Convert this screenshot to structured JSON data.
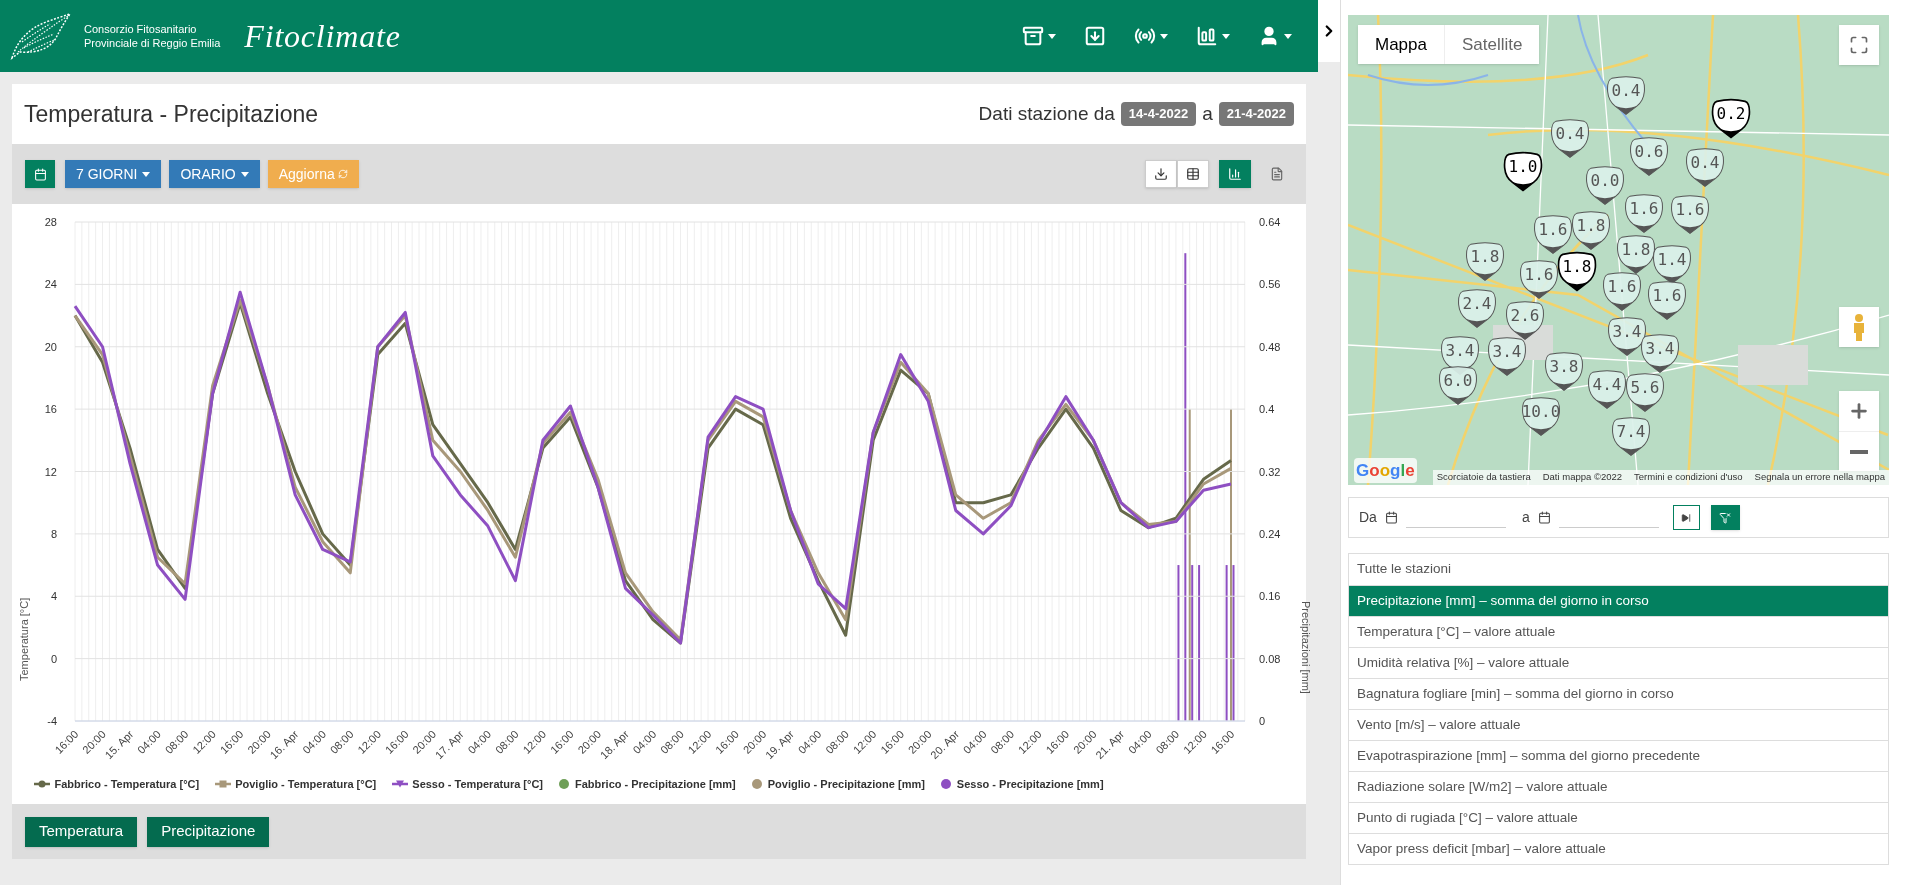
{
  "header": {
    "org_line_1": "Consorzio Fitosanitario",
    "org_line_2": "Provinciale di Reggio Emilia",
    "app_name": "Fitoclimate",
    "menu": [
      {
        "kind": "archive",
        "caret": true
      },
      {
        "kind": "download",
        "caret": false
      },
      {
        "kind": "broadcast",
        "caret": true
      },
      {
        "kind": "chart",
        "caret": true
      },
      {
        "kind": "user",
        "caret": true
      }
    ]
  },
  "panel": {
    "title": "Temperatura - Precipitazione",
    "range_label": "Dati stazione da",
    "date_from": "14-4-2022",
    "range_sep": "a",
    "date_to": "21-4-2022"
  },
  "toolbar": {
    "period": "7 GIORNI",
    "resolution": "ORARIO",
    "refresh": "Aggiorna",
    "views": [
      {
        "kind": "table",
        "selected": false
      },
      {
        "kind": "chart",
        "selected": true
      },
      {
        "kind": "report",
        "selected": false
      }
    ]
  },
  "temperature_chart": {
    "chart_data": {
      "type": "line",
      "grid": true,
      "ylabel": "Temperatura [°C]",
      "categories": [
        null,
        null,
        null,
        null,
        null,
        null,
        null,
        null,
        null,
        null,
        null,
        null,
        null,
        null,
        null,
        null,
        null,
        null,
        null,
        null,
        null,
        null,
        null,
        null,
        null,
        null,
        null,
        null,
        null,
        null,
        null,
        null,
        null,
        null,
        null,
        null,
        null,
        null,
        null,
        null,
        null,
        null,
        null
      ],
      "ylim": [
        -4,
        28
      ],
      "yticks": [
        -4,
        0,
        4,
        8,
        12,
        16,
        20,
        24,
        28
      ],
      "series": [
        {
          "name": "Fabbrico - Temperatura [°C]",
          "color": "#66694a",
          "values": [
            22,
            19,
            13.5,
            7,
            4.5,
            17,
            22.8,
            17,
            12,
            8,
            6,
            19.5,
            21.5,
            15,
            12.5,
            10,
            7,
            13.5,
            15.5,
            11,
            5,
            2.5,
            1,
            13.5,
            16,
            15,
            9,
            5,
            1.5,
            14,
            18.5,
            17,
            10,
            10,
            10.5,
            13.5,
            16,
            13.5,
            9.5,
            8.4,
            9,
            11.5,
            12.7
          ]
        },
        {
          "name": "Poviglio - Temperatura [°C]",
          "color": "#a8987a",
          "values": [
            22,
            19.5,
            13,
            6.5,
            4.8,
            17.5,
            23,
            17.5,
            11,
            7.5,
            5.5,
            20,
            22,
            14,
            12,
            9.5,
            6.5,
            13.8,
            15.8,
            11.5,
            5.5,
            3,
            1.2,
            14,
            16.5,
            15.5,
            9.5,
            5.5,
            2.5,
            14.5,
            19,
            17,
            10.5,
            9,
            10,
            14,
            16.3,
            14,
            10,
            8.6,
            8.8,
            11.2,
            12.2
          ]
        },
        {
          "name": "Sesso - Temperatura [°C]",
          "color": "#8e4fc2",
          "values": [
            22.6,
            20,
            12.5,
            6,
            3.8,
            17,
            23.5,
            17.5,
            10.5,
            7,
            6.2,
            20,
            22.2,
            13,
            10.5,
            8.5,
            5,
            14,
            16.2,
            11,
            4.5,
            2.8,
            1,
            14.2,
            16.8,
            16,
            9.5,
            4.8,
            3.2,
            14.5,
            19.5,
            16.5,
            9.5,
            8,
            9.8,
            13.8,
            16.8,
            14,
            10,
            8.4,
            8.8,
            10.8,
            11.2
          ]
        }
      ]
    }
  },
  "precipitation_chart": {
    "chart_data": {
      "type": "bar",
      "grid": true,
      "ylabel": "Precipitazioni [mm]",
      "categories": [
        "16:00",
        null,
        null,
        null,
        "20:00",
        null,
        null,
        null,
        "15. Apr",
        null,
        null,
        null,
        "04:00",
        null,
        null,
        null,
        "08:00",
        null,
        null,
        null,
        "12:00",
        null,
        null,
        null,
        "16:00",
        null,
        null,
        null,
        "20:00",
        null,
        null,
        null,
        "16. Apr",
        null,
        null,
        null,
        "04:00",
        null,
        null,
        null,
        "08:00",
        null,
        null,
        null,
        "12:00",
        null,
        null,
        null,
        "16:00",
        null,
        null,
        null,
        "20:00",
        null,
        null,
        null,
        "17. Apr",
        null,
        null,
        null,
        "04:00",
        null,
        null,
        null,
        "08:00",
        null,
        null,
        null,
        "12:00",
        null,
        null,
        null,
        "16:00",
        null,
        null,
        null,
        "20:00",
        null,
        null,
        null,
        "18. Apr",
        null,
        null,
        null,
        "04:00",
        null,
        null,
        null,
        "08:00",
        null,
        null,
        null,
        "12:00",
        null,
        null,
        null,
        "16:00",
        null,
        null,
        null,
        "20:00",
        null,
        null,
        null,
        "19. Apr",
        null,
        null,
        null,
        "04:00",
        null,
        null,
        null,
        "08:00",
        null,
        null,
        null,
        "12:00",
        null,
        null,
        null,
        "16:00",
        null,
        null,
        null,
        "20:00",
        null,
        null,
        null,
        "20. Apr",
        null,
        null,
        null,
        "04:00",
        null,
        null,
        null,
        "08:00",
        null,
        null,
        null,
        "12:00",
        null,
        null,
        null,
        "16:00",
        null,
        null,
        null,
        "20:00",
        null,
        null,
        null,
        "21. Apr",
        null,
        null,
        null,
        "04:00",
        null,
        null,
        null,
        "08:00",
        null,
        null,
        null,
        "12:00",
        null,
        null,
        null,
        "16:00"
      ],
      "ylim": [
        0,
        0.64
      ],
      "yticks": [
        0,
        0.08,
        0.16,
        0.24,
        0.32,
        0.4,
        0.48,
        0.56,
        0.64
      ],
      "series": [
        {
          "name": "Fabbrico - Precipitazione [mm]",
          "color": "#6e9f57",
          "values": [
            0,
            0,
            0,
            0,
            0,
            0,
            0,
            0,
            0,
            0,
            0,
            0,
            0,
            0,
            0,
            0,
            0,
            0,
            0,
            0,
            0,
            0,
            0,
            0,
            0,
            0,
            0,
            0,
            0,
            0,
            0,
            0,
            0,
            0,
            0,
            0,
            0,
            0,
            0,
            0,
            0,
            0,
            0,
            0,
            0,
            0,
            0,
            0,
            0,
            0,
            0,
            0,
            0,
            0,
            0,
            0,
            0,
            0,
            0,
            0,
            0,
            0,
            0,
            0,
            0,
            0,
            0,
            0,
            0,
            0,
            0,
            0,
            0,
            0,
            0,
            0,
            0,
            0,
            0,
            0,
            0,
            0,
            0,
            0,
            0,
            0,
            0,
            0,
            0,
            0,
            0,
            0,
            0,
            0,
            0,
            0,
            0,
            0,
            0,
            0,
            0,
            0,
            0,
            0,
            0,
            0,
            0,
            0,
            0,
            0,
            0,
            0,
            0,
            0,
            0,
            0,
            0,
            0,
            0,
            0,
            0,
            0,
            0,
            0,
            0,
            0,
            0,
            0,
            0,
            0,
            0,
            0,
            0,
            0,
            0,
            0,
            0,
            0,
            0,
            0,
            0,
            0,
            0,
            0,
            0,
            0,
            0,
            0,
            0,
            0,
            0,
            0,
            0,
            0,
            0,
            0,
            0,
            0,
            0,
            0,
            0,
            0,
            0,
            0,
            0,
            0,
            0,
            0,
            0
          ]
        },
        {
          "name": "Poviglio - Precipitazione [mm]",
          "color": "#a8987a",
          "values": [
            0,
            0,
            0,
            0,
            0,
            0,
            0,
            0,
            0,
            0,
            0,
            0,
            0,
            0,
            0,
            0,
            0,
            0,
            0,
            0,
            0,
            0,
            0,
            0,
            0,
            0,
            0,
            0,
            0,
            0,
            0,
            0,
            0,
            0,
            0,
            0,
            0,
            0,
            0,
            0,
            0,
            0,
            0,
            0,
            0,
            0,
            0,
            0,
            0,
            0,
            0,
            0,
            0,
            0,
            0,
            0,
            0,
            0,
            0,
            0,
            0,
            0,
            0,
            0,
            0,
            0,
            0,
            0,
            0,
            0,
            0,
            0,
            0,
            0,
            0,
            0,
            0,
            0,
            0,
            0,
            0,
            0,
            0,
            0,
            0,
            0,
            0,
            0,
            0,
            0,
            0,
            0,
            0,
            0,
            0,
            0,
            0,
            0,
            0,
            0,
            0,
            0,
            0,
            0,
            0,
            0,
            0,
            0,
            0,
            0,
            0,
            0,
            0,
            0,
            0,
            0,
            0,
            0,
            0,
            0,
            0,
            0,
            0,
            0,
            0,
            0,
            0,
            0,
            0,
            0,
            0,
            0,
            0,
            0,
            0,
            0,
            0,
            0,
            0,
            0,
            0,
            0,
            0,
            0,
            0,
            0,
            0,
            0,
            0,
            0,
            0,
            0,
            0,
            0,
            0,
            0,
            0,
            0,
            0,
            0,
            0,
            0,
            0.4,
            0,
            0,
            0,
            0,
            0,
            0.4
          ]
        },
        {
          "name": "Sesso - Precipitazione [mm]",
          "color": "#8e4fc2",
          "values": [
            0,
            0,
            0,
            0,
            0,
            0,
            0,
            0,
            0,
            0,
            0,
            0,
            0,
            0,
            0,
            0,
            0,
            0,
            0,
            0,
            0,
            0,
            0,
            0,
            0,
            0,
            0,
            0,
            0,
            0,
            0,
            0,
            0,
            0,
            0,
            0,
            0,
            0,
            0,
            0,
            0,
            0,
            0,
            0,
            0,
            0,
            0,
            0,
            0,
            0,
            0,
            0,
            0,
            0,
            0,
            0,
            0,
            0,
            0,
            0,
            0,
            0,
            0,
            0,
            0,
            0,
            0,
            0,
            0,
            0,
            0,
            0,
            0,
            0,
            0,
            0,
            0,
            0,
            0,
            0,
            0,
            0,
            0,
            0,
            0,
            0,
            0,
            0,
            0,
            0,
            0,
            0,
            0,
            0,
            0,
            0,
            0,
            0,
            0,
            0,
            0,
            0,
            0,
            0,
            0,
            0,
            0,
            0,
            0,
            0,
            0,
            0,
            0,
            0,
            0,
            0,
            0,
            0,
            0,
            0,
            0,
            0,
            0,
            0,
            0,
            0,
            0,
            0,
            0,
            0,
            0,
            0,
            0,
            0,
            0,
            0,
            0,
            0,
            0,
            0,
            0,
            0,
            0,
            0,
            0,
            0,
            0,
            0,
            0,
            0,
            0,
            0,
            0,
            0,
            0,
            0,
            0,
            0,
            0,
            0,
            0.2,
            0.6,
            0.2,
            0.2,
            0,
            0,
            0,
            0.2,
            0.2
          ]
        }
      ]
    }
  },
  "bottom_buttons": [
    "Temperatura",
    "Precipitazione"
  ],
  "map": {
    "tabs": [
      {
        "label": "Mappa",
        "selected": true
      },
      {
        "label": "Satellite",
        "selected": false
      }
    ],
    "google_logo": "Google",
    "attribution": [
      "Scorciatoie da tastiera",
      "Dati mappa ©2022",
      "Termini e condizioni d'uso",
      "Segnala un errore nella mappa"
    ],
    "markers": [
      {
        "value": "0.4",
        "highlighted": false
      },
      {
        "value": "0.2",
        "highlighted": true
      },
      {
        "value": "0.4",
        "highlighted": false
      },
      {
        "value": "1.0",
        "highlighted": true
      },
      {
        "value": "0.6",
        "highlighted": false
      },
      {
        "value": "0.4",
        "highlighted": false
      },
      {
        "value": "0.0",
        "highlighted": false
      },
      {
        "value": "1.6",
        "highlighted": false
      },
      {
        "value": "1.6",
        "highlighted": false
      },
      {
        "value": "1.6",
        "highlighted": false
      },
      {
        "value": "1.8",
        "highlighted": false
      },
      {
        "value": "1.8",
        "highlighted": false
      },
      {
        "value": "1.8",
        "highlighted": true
      },
      {
        "value": "1.8",
        "highlighted": false
      },
      {
        "value": "1.4",
        "highlighted": false
      },
      {
        "value": "1.6",
        "highlighted": false
      },
      {
        "value": "1.6",
        "highlighted": false
      },
      {
        "value": "1.6",
        "highlighted": false
      },
      {
        "value": "2.4",
        "highlighted": false
      },
      {
        "value": "2.6",
        "highlighted": false
      },
      {
        "value": "3.4",
        "highlighted": false
      },
      {
        "value": "3.4",
        "highlighted": false
      },
      {
        "value": "3.4",
        "highlighted": false
      },
      {
        "value": "3.4",
        "highlighted": false
      },
      {
        "value": "3.8",
        "highlighted": false
      },
      {
        "value": "6.0",
        "highlighted": false
      },
      {
        "value": "4.4",
        "highlighted": false
      },
      {
        "value": "5.6",
        "highlighted": false
      },
      {
        "value": "10.0",
        "highlighted": false
      },
      {
        "value": "7.4",
        "highlighted": false
      }
    ]
  },
  "date_filter": {
    "from_label": "Da",
    "to_label": "a"
  },
  "variables": [
    {
      "label": "Tutte le stazioni",
      "selected": false
    },
    {
      "label": "Precipitazione [mm] – somma del giorno in corso",
      "selected": true
    },
    {
      "label": "Temperatura [°C] – valore attuale",
      "selected": false
    },
    {
      "label": "Umidità relativa [%] – valore attuale",
      "selected": false
    },
    {
      "label": "Bagnatura fogliare [min] – somma del giorno in corso",
      "selected": false
    },
    {
      "label": "Vento [m/s] – valore attuale",
      "selected": false
    },
    {
      "label": "Evapotraspirazione [mm] – somma del giorno precedente",
      "selected": false
    },
    {
      "label": "Radiazione solare [W/m2] – valore attuale",
      "selected": false
    },
    {
      "label": "Punto di rugiada [°C] – valore attuale",
      "selected": false
    },
    {
      "label": "Vapor press deficit [mbar] – valore attuale",
      "selected": false
    }
  ]
}
